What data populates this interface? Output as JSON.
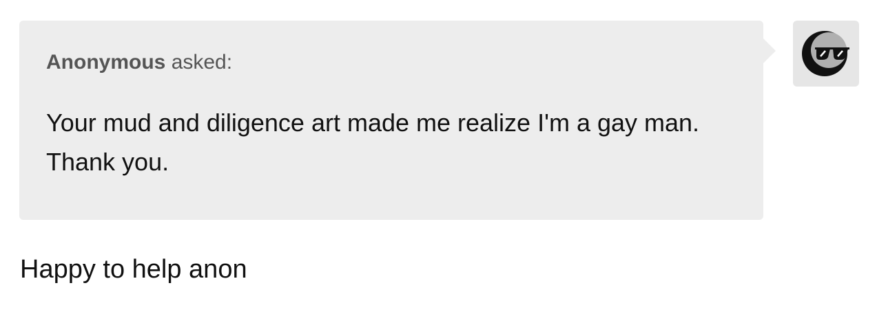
{
  "ask": {
    "asker": "Anonymous",
    "asked_label": "asked:",
    "question": "Your mud and diligence art made me realize I'm a gay man. Thank you."
  },
  "avatar": {
    "icon": "sunglasses-moon-icon"
  },
  "answer": {
    "text": "Happy to help anon"
  }
}
